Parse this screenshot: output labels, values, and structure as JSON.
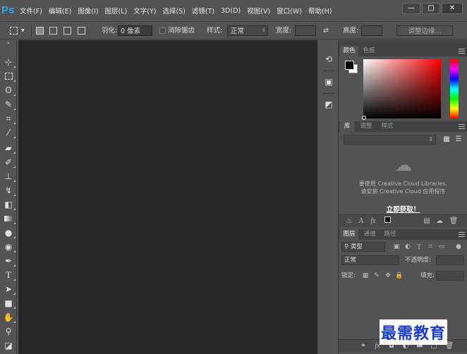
{
  "app": {
    "logo": "Ps"
  },
  "menu": [
    "文件(F)",
    "编辑(E)",
    "图像(I)",
    "图层(L)",
    "文字(Y)",
    "选择(S)",
    "滤镜(T)",
    "3D(D)",
    "视图(V)",
    "窗口(W)",
    "帮助(H)"
  ],
  "window_controls": {
    "minimize": "—",
    "maximize": "□",
    "close": "✕"
  },
  "options": {
    "feather_label": "羽化:",
    "feather_value": "0 像素",
    "antialias_label": "消除锯齿",
    "style_label": "样式:",
    "style_value": "正常",
    "width_label": "宽度:",
    "height_label": "高度:",
    "refine_edge": "调整边缘..."
  },
  "color_panel": {
    "tabs": [
      "颜色",
      "色板"
    ],
    "foreground": "#000000",
    "background": "#ffffff"
  },
  "library_panel": {
    "tabs": [
      "库",
      "调整",
      "样式"
    ],
    "message_line1": "要使用 Creative Cloud Libraries,",
    "message_line2": "请安装 Creative Cloud 应用程序",
    "link": "立即获取！"
  },
  "layers_panel": {
    "tabs": [
      "图层",
      "通道",
      "路径"
    ],
    "filter_label": "类型",
    "blend_mode": "正常",
    "opacity_label": "不透明度:",
    "lock_label": "锁定:",
    "fill_label": "填充:"
  },
  "watermark": "最需教育"
}
